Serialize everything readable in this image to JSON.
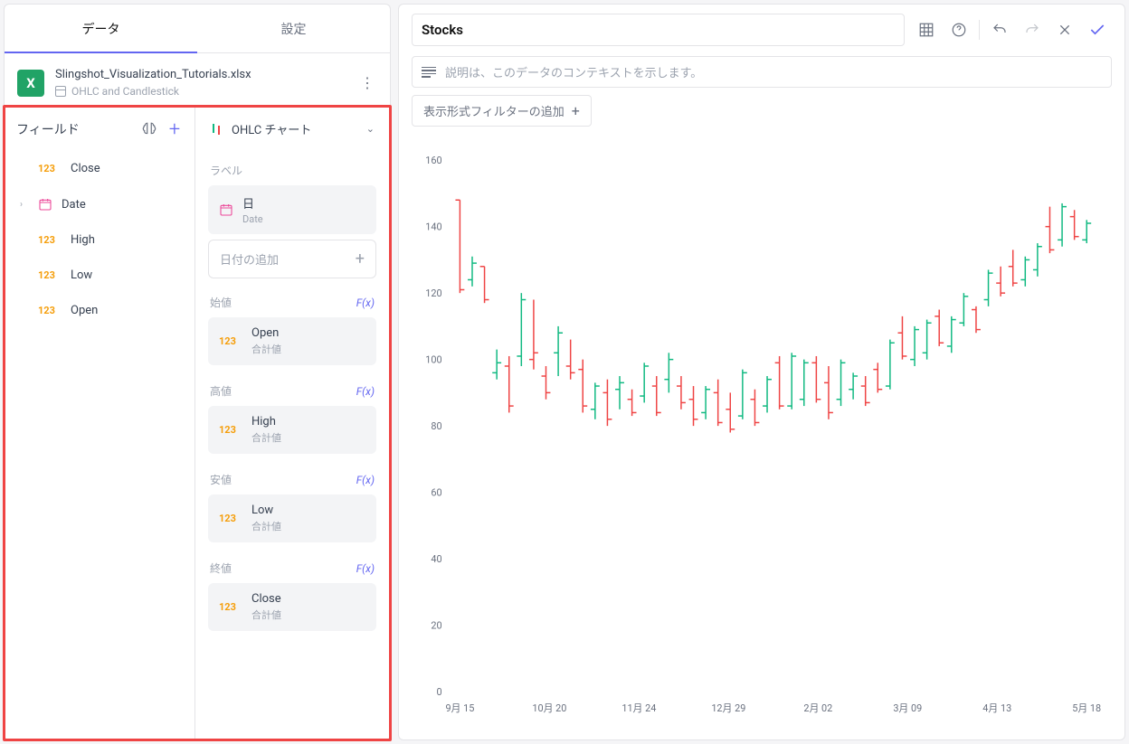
{
  "tabs": {
    "data": "データ",
    "settings": "設定"
  },
  "file": {
    "name": "Slingshot_Visualization_Tutorials.xlsx",
    "sheet": "OHLC and Candlestick"
  },
  "fields": {
    "header": "フィールド",
    "items": [
      {
        "type": "num",
        "label": "Close"
      },
      {
        "type": "date",
        "label": "Date",
        "expandable": true
      },
      {
        "type": "num",
        "label": "High"
      },
      {
        "type": "num",
        "label": "Low"
      },
      {
        "type": "num",
        "label": "Open"
      }
    ]
  },
  "chartType": "OHLC チャート",
  "sections": {
    "label": "ラベル",
    "date_chip": {
      "main": "日",
      "sub": "Date"
    },
    "add_date": "日付の追加",
    "open": {
      "title": "始値",
      "fx": "F(x)",
      "chip": {
        "main": "Open",
        "sub": "合計値"
      }
    },
    "high": {
      "title": "高値",
      "fx": "F(x)",
      "chip": {
        "main": "High",
        "sub": "合計値"
      }
    },
    "low": {
      "title": "安値",
      "fx": "F(x)",
      "chip": {
        "main": "Low",
        "sub": "合計値"
      }
    },
    "close": {
      "title": "終値",
      "fx": "F(x)",
      "chip": {
        "main": "Close",
        "sub": "合計値"
      }
    }
  },
  "right": {
    "title": "Stocks",
    "desc_placeholder": "説明は、このデータのコンテキストを示します。",
    "add_filter": "表示形式フィルターの追加"
  },
  "chart_data": {
    "type": "ohlc",
    "ylabel": "",
    "ylim": [
      0,
      160
    ],
    "yticks": [
      0,
      20,
      40,
      60,
      80,
      100,
      120,
      140,
      160
    ],
    "xticks": [
      "9月 15",
      "10月 20",
      "11月 24",
      "12月 29",
      "2月 02",
      "3月 09",
      "4月 13",
      "5月 18"
    ],
    "bars": [
      {
        "x": 0,
        "o": 148,
        "h": 148,
        "l": 120,
        "c": 121,
        "d": "d"
      },
      {
        "x": 1,
        "o": 124,
        "h": 131,
        "l": 122,
        "c": 129,
        "d": "u"
      },
      {
        "x": 2,
        "o": 128,
        "h": 128,
        "l": 117,
        "c": 118,
        "d": "d"
      },
      {
        "x": 3,
        "o": 96,
        "h": 103,
        "l": 94,
        "c": 99,
        "d": "u"
      },
      {
        "x": 4,
        "o": 98,
        "h": 101,
        "l": 84,
        "c": 86,
        "d": "d"
      },
      {
        "x": 5,
        "o": 101,
        "h": 120,
        "l": 98,
        "c": 118,
        "d": "u"
      },
      {
        "x": 6,
        "o": 100,
        "h": 118,
        "l": 97,
        "c": 102,
        "d": "d"
      },
      {
        "x": 7,
        "o": 95,
        "h": 98,
        "l": 88,
        "c": 90,
        "d": "d"
      },
      {
        "x": 8,
        "o": 102,
        "h": 110,
        "l": 95,
        "c": 108,
        "d": "u"
      },
      {
        "x": 9,
        "o": 98,
        "h": 106,
        "l": 94,
        "c": 96,
        "d": "d"
      },
      {
        "x": 10,
        "o": 97,
        "h": 100,
        "l": 84,
        "c": 86,
        "d": "d"
      },
      {
        "x": 11,
        "o": 85,
        "h": 93,
        "l": 82,
        "c": 92,
        "d": "u"
      },
      {
        "x": 12,
        "o": 90,
        "h": 94,
        "l": 80,
        "c": 82,
        "d": "d"
      },
      {
        "x": 13,
        "o": 91,
        "h": 95,
        "l": 85,
        "c": 93,
        "d": "u"
      },
      {
        "x": 14,
        "o": 88,
        "h": 91,
        "l": 83,
        "c": 84,
        "d": "d"
      },
      {
        "x": 15,
        "o": 89,
        "h": 99,
        "l": 87,
        "c": 98,
        "d": "u"
      },
      {
        "x": 16,
        "o": 92,
        "h": 95,
        "l": 83,
        "c": 84,
        "d": "d"
      },
      {
        "x": 17,
        "o": 94,
        "h": 102,
        "l": 90,
        "c": 100,
        "d": "u"
      },
      {
        "x": 18,
        "o": 92,
        "h": 95,
        "l": 85,
        "c": 87,
        "d": "d"
      },
      {
        "x": 19,
        "o": 88,
        "h": 92,
        "l": 80,
        "c": 82,
        "d": "d"
      },
      {
        "x": 20,
        "o": 84,
        "h": 92,
        "l": 82,
        "c": 91,
        "d": "u"
      },
      {
        "x": 21,
        "o": 90,
        "h": 94,
        "l": 80,
        "c": 81,
        "d": "d"
      },
      {
        "x": 22,
        "o": 85,
        "h": 90,
        "l": 78,
        "c": 79,
        "d": "d"
      },
      {
        "x": 23,
        "o": 83,
        "h": 97,
        "l": 82,
        "c": 96,
        "d": "u"
      },
      {
        "x": 24,
        "o": 88,
        "h": 91,
        "l": 80,
        "c": 81,
        "d": "d"
      },
      {
        "x": 25,
        "o": 86,
        "h": 95,
        "l": 84,
        "c": 94,
        "d": "u"
      },
      {
        "x": 26,
        "o": 99,
        "h": 101,
        "l": 85,
        "c": 86,
        "d": "d"
      },
      {
        "x": 27,
        "o": 86,
        "h": 102,
        "l": 85,
        "c": 101,
        "d": "u"
      },
      {
        "x": 28,
        "o": 88,
        "h": 100,
        "l": 86,
        "c": 99,
        "d": "u"
      },
      {
        "x": 29,
        "o": 99,
        "h": 101,
        "l": 87,
        "c": 88,
        "d": "d"
      },
      {
        "x": 30,
        "o": 93,
        "h": 98,
        "l": 82,
        "c": 84,
        "d": "d"
      },
      {
        "x": 31,
        "o": 88,
        "h": 100,
        "l": 86,
        "c": 99,
        "d": "u"
      },
      {
        "x": 32,
        "o": 91,
        "h": 96,
        "l": 88,
        "c": 95,
        "d": "u"
      },
      {
        "x": 33,
        "o": 92,
        "h": 95,
        "l": 86,
        "c": 87,
        "d": "d"
      },
      {
        "x": 34,
        "o": 97,
        "h": 99,
        "l": 90,
        "c": 91,
        "d": "d"
      },
      {
        "x": 35,
        "o": 92,
        "h": 106,
        "l": 91,
        "c": 105,
        "d": "u"
      },
      {
        "x": 36,
        "o": 108,
        "h": 113,
        "l": 100,
        "c": 101,
        "d": "d"
      },
      {
        "x": 37,
        "o": 100,
        "h": 110,
        "l": 98,
        "c": 109,
        "d": "u"
      },
      {
        "x": 38,
        "o": 102,
        "h": 112,
        "l": 100,
        "c": 111,
        "d": "u"
      },
      {
        "x": 39,
        "o": 113,
        "h": 115,
        "l": 104,
        "c": 105,
        "d": "d"
      },
      {
        "x": 40,
        "o": 104,
        "h": 113,
        "l": 102,
        "c": 112,
        "d": "u"
      },
      {
        "x": 41,
        "o": 111,
        "h": 120,
        "l": 110,
        "c": 119,
        "d": "u"
      },
      {
        "x": 42,
        "o": 115,
        "h": 116,
        "l": 108,
        "c": 109,
        "d": "d"
      },
      {
        "x": 43,
        "o": 118,
        "h": 127,
        "l": 116,
        "c": 126,
        "d": "u"
      },
      {
        "x": 44,
        "o": 123,
        "h": 128,
        "l": 119,
        "c": 120,
        "d": "d"
      },
      {
        "x": 45,
        "o": 128,
        "h": 133,
        "l": 122,
        "c": 123,
        "d": "d"
      },
      {
        "x": 46,
        "o": 124,
        "h": 131,
        "l": 122,
        "c": 130,
        "d": "u"
      },
      {
        "x": 47,
        "o": 127,
        "h": 135,
        "l": 125,
        "c": 134,
        "d": "u"
      },
      {
        "x": 48,
        "o": 140,
        "h": 146,
        "l": 132,
        "c": 133,
        "d": "d"
      },
      {
        "x": 49,
        "o": 136,
        "h": 147,
        "l": 134,
        "c": 146,
        "d": "u"
      },
      {
        "x": 50,
        "o": 143,
        "h": 145,
        "l": 136,
        "c": 137,
        "d": "d"
      },
      {
        "x": 51,
        "o": 136,
        "h": 142,
        "l": 135,
        "c": 141,
        "d": "u"
      }
    ]
  }
}
